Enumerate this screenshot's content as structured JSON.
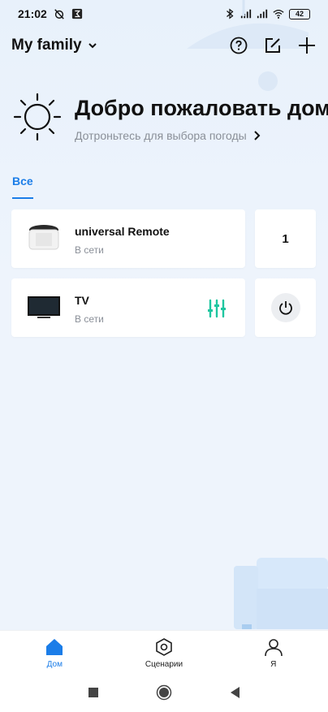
{
  "status_bar": {
    "time": "21:02",
    "battery": "42"
  },
  "header": {
    "family_name": "My family"
  },
  "weather": {
    "welcome": "Добро пожаловать дом",
    "hint": "Дотроньтесь для выбора погоды"
  },
  "tabs": [
    {
      "label": "Все",
      "active": true
    }
  ],
  "devices": [
    {
      "name": "universal Remote",
      "status": "В сети",
      "side_value": "1"
    },
    {
      "name": "TV",
      "status": "В сети"
    }
  ],
  "bottom_nav": [
    {
      "label": "Дом",
      "icon": "home-icon",
      "active": true
    },
    {
      "label": "Сценарии",
      "icon": "scenes-icon",
      "active": false
    },
    {
      "label": "Я",
      "icon": "profile-icon",
      "active": false
    }
  ],
  "colors": {
    "accent": "#1b7de8",
    "control_green": "#1ec6a0",
    "background": "#eef4fc"
  }
}
